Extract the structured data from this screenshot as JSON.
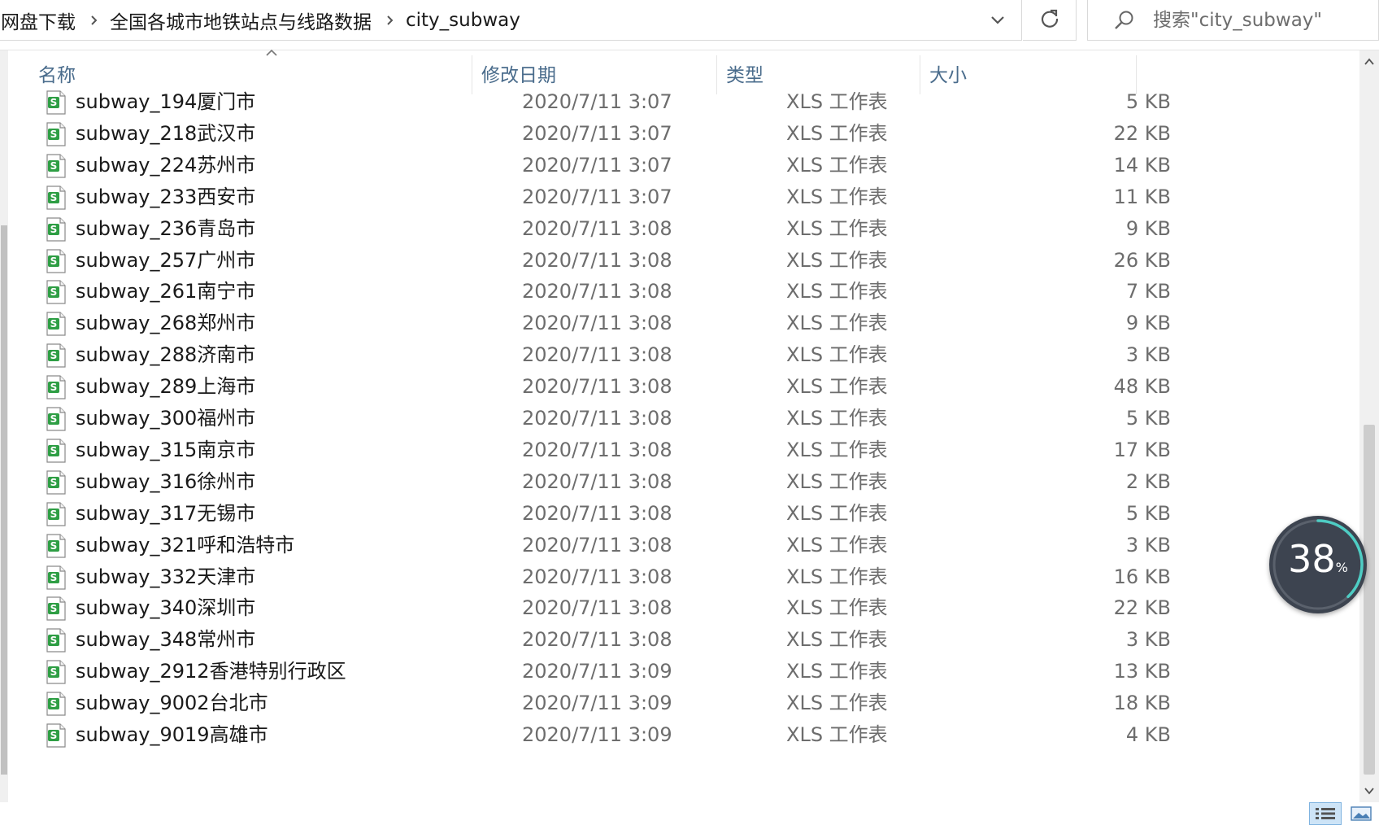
{
  "address": {
    "breadcrumbs": [
      "网盘下载",
      "全国各城市地铁站点与线路数据",
      "city_subway"
    ]
  },
  "search": {
    "placeholder": "搜索\"city_subway\""
  },
  "columns": {
    "name": "名称",
    "date": "修改日期",
    "type": "类型",
    "size": "大小"
  },
  "files": [
    {
      "name": "subway_194厦门市",
      "date": "2020/7/11 3:07",
      "type": "XLS 工作表",
      "size": "5 KB"
    },
    {
      "name": "subway_218武汉市",
      "date": "2020/7/11 3:07",
      "type": "XLS 工作表",
      "size": "22 KB"
    },
    {
      "name": "subway_224苏州市",
      "date": "2020/7/11 3:07",
      "type": "XLS 工作表",
      "size": "14 KB"
    },
    {
      "name": "subway_233西安市",
      "date": "2020/7/11 3:07",
      "type": "XLS 工作表",
      "size": "11 KB"
    },
    {
      "name": "subway_236青岛市",
      "date": "2020/7/11 3:08",
      "type": "XLS 工作表",
      "size": "9 KB"
    },
    {
      "name": "subway_257广州市",
      "date": "2020/7/11 3:08",
      "type": "XLS 工作表",
      "size": "26 KB"
    },
    {
      "name": "subway_261南宁市",
      "date": "2020/7/11 3:08",
      "type": "XLS 工作表",
      "size": "7 KB"
    },
    {
      "name": "subway_268郑州市",
      "date": "2020/7/11 3:08",
      "type": "XLS 工作表",
      "size": "9 KB"
    },
    {
      "name": "subway_288济南市",
      "date": "2020/7/11 3:08",
      "type": "XLS 工作表",
      "size": "3 KB"
    },
    {
      "name": "subway_289上海市",
      "date": "2020/7/11 3:08",
      "type": "XLS 工作表",
      "size": "48 KB"
    },
    {
      "name": "subway_300福州市",
      "date": "2020/7/11 3:08",
      "type": "XLS 工作表",
      "size": "5 KB"
    },
    {
      "name": "subway_315南京市",
      "date": "2020/7/11 3:08",
      "type": "XLS 工作表",
      "size": "17 KB"
    },
    {
      "name": "subway_316徐州市",
      "date": "2020/7/11 3:08",
      "type": "XLS 工作表",
      "size": "2 KB"
    },
    {
      "name": "subway_317无锡市",
      "date": "2020/7/11 3:08",
      "type": "XLS 工作表",
      "size": "5 KB"
    },
    {
      "name": "subway_321呼和浩特市",
      "date": "2020/7/11 3:08",
      "type": "XLS 工作表",
      "size": "3 KB"
    },
    {
      "name": "subway_332天津市",
      "date": "2020/7/11 3:08",
      "type": "XLS 工作表",
      "size": "16 KB"
    },
    {
      "name": "subway_340深圳市",
      "date": "2020/7/11 3:08",
      "type": "XLS 工作表",
      "size": "22 KB"
    },
    {
      "name": "subway_348常州市",
      "date": "2020/7/11 3:08",
      "type": "XLS 工作表",
      "size": "3 KB"
    },
    {
      "name": "subway_2912香港特别行政区",
      "date": "2020/7/11 3:09",
      "type": "XLS 工作表",
      "size": "13 KB"
    },
    {
      "name": "subway_9002台北市",
      "date": "2020/7/11 3:09",
      "type": "XLS 工作表",
      "size": "18 KB"
    },
    {
      "name": "subway_9019高雄市",
      "date": "2020/7/11 3:09",
      "type": "XLS 工作表",
      "size": "4 KB"
    }
  ],
  "progress_badge": {
    "value": "38",
    "unit": "%",
    "fraction": 0.38,
    "ring_color": "#4ecdc4"
  },
  "icons": {
    "file": "xls-spreadsheet-icon",
    "chevron": "chevron-right-icon",
    "dropdown": "chevron-down-icon",
    "refresh": "refresh-icon",
    "search": "search-icon"
  },
  "colors": {
    "header_text": "#4a6c8c",
    "file_icon_green": "#2e9e44"
  }
}
